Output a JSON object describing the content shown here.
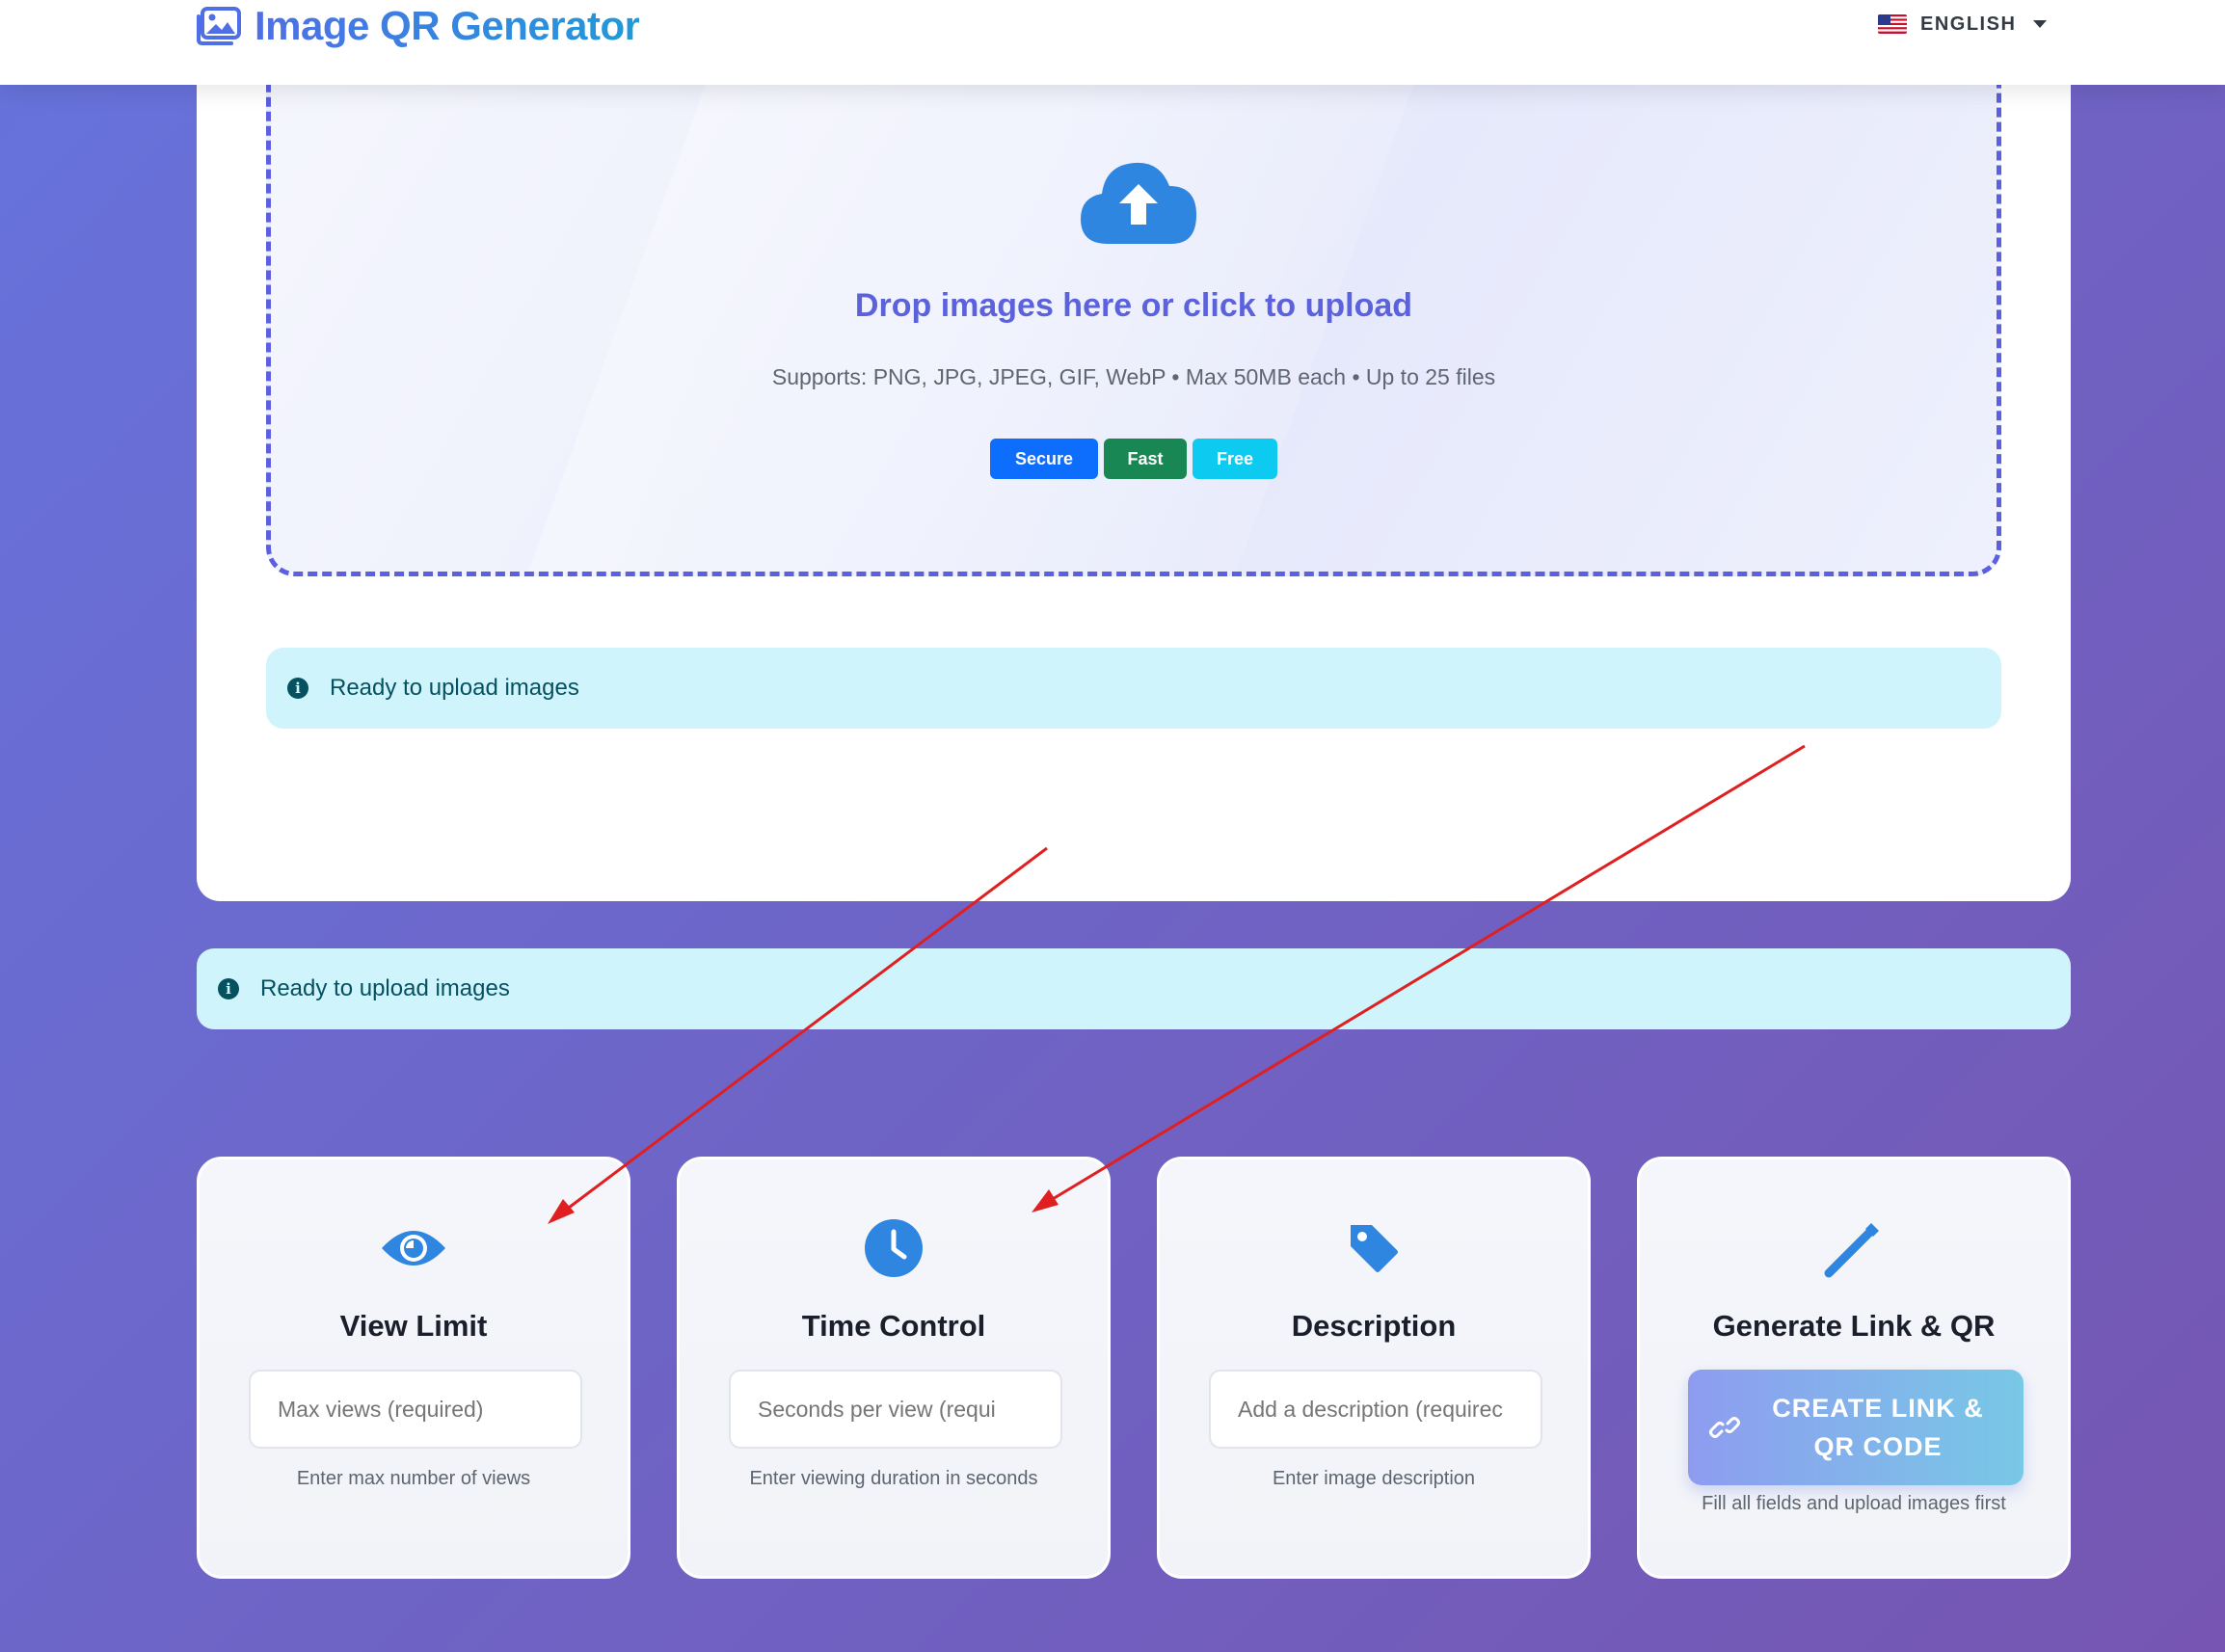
{
  "header": {
    "title": "Image QR Generator",
    "language": "ENGLISH"
  },
  "dropzone": {
    "title": "Drop images here or click to upload",
    "subtitle": "Supports: PNG, JPG, JPEG, GIF, WebP • Max 50MB each • Up to 25 files",
    "badges": [
      "Secure",
      "Fast",
      "Free"
    ]
  },
  "status": {
    "inner_message": "Ready to upload images",
    "outer_message": "Ready to upload images"
  },
  "features": [
    {
      "title": "View Limit",
      "placeholder": "Max views (required)",
      "help": "Enter max number of views",
      "icon": "eye-icon"
    },
    {
      "title": "Time Control",
      "placeholder": "Seconds per view (requi",
      "help": "Enter viewing duration in seconds",
      "icon": "clock-icon"
    },
    {
      "title": "Description",
      "placeholder": "Add a description (requirec",
      "help": "Enter image description",
      "icon": "tag-icon"
    },
    {
      "title": "Generate Link & QR",
      "button": "CREATE LINK & QR CODE",
      "help": "Fill all fields and upload images first",
      "icon": "magic-wand-icon"
    }
  ],
  "colors": {
    "accent": "#5c62dc",
    "icon": "#2f86e0",
    "info_bg": "#cff4fc",
    "info_text": "#055160",
    "annotation_arrow": "#e02020"
  }
}
